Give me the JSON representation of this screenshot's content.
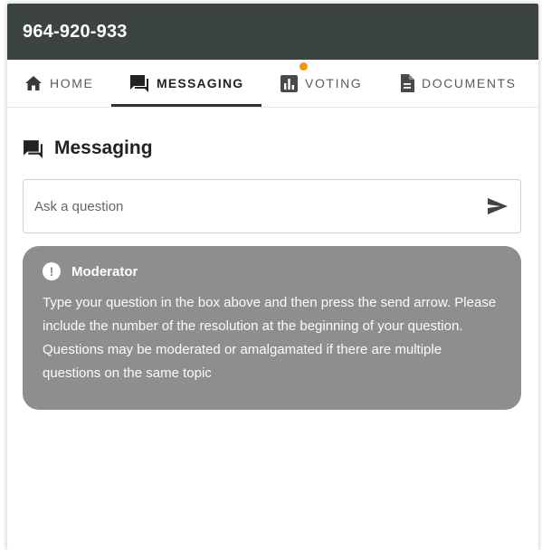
{
  "header": {
    "title": "964-920-933"
  },
  "tabs": [
    {
      "label": "HOME",
      "icon": "home-icon"
    },
    {
      "label": "MESSAGING",
      "icon": "chat-icon",
      "active": true
    },
    {
      "label": "VOTING",
      "icon": "bar-chart-icon",
      "has_notification": true
    },
    {
      "label": "DOCUMENTS",
      "icon": "document-icon"
    }
  ],
  "messaging": {
    "title": "Messaging",
    "input_placeholder": "Ask a question",
    "send_icon": "send-icon"
  },
  "moderator": {
    "title": "Moderator",
    "message": "Type your question in the box above and then press the send arrow. Please include the number of the resolution at the beginning of your question. Questions may be moderated or amalgamated if there are multiple questions on the same topic"
  },
  "colors": {
    "header_bg": "#3c4442",
    "notification_dot": "#f29410",
    "moderator_card_bg": "#8f8e8d"
  }
}
